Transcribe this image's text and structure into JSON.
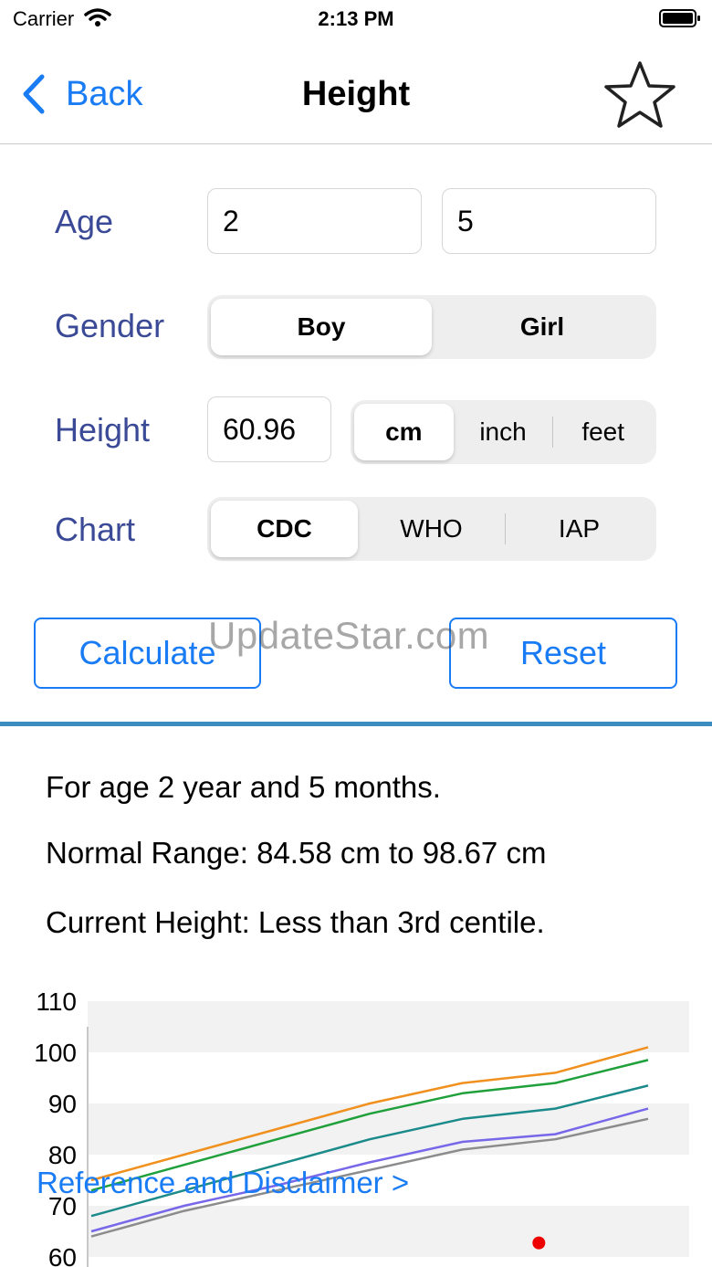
{
  "status_bar": {
    "carrier": "Carrier",
    "time": "2:13 PM"
  },
  "nav": {
    "back_label": "Back",
    "title": "Height"
  },
  "form": {
    "age_label": "Age",
    "age_years": "2",
    "age_months": "5",
    "gender_label": "Gender",
    "gender_options": [
      "Boy",
      "Girl"
    ],
    "gender_selected": "Boy",
    "height_label": "Height",
    "height_value": "60.96",
    "unit_options": [
      "cm",
      "inch",
      "feet"
    ],
    "unit_selected": "cm",
    "chart_label": "Chart",
    "chart_options": [
      "CDC",
      "WHO",
      "IAP"
    ],
    "chart_selected": "CDC"
  },
  "buttons": {
    "calculate": "Calculate",
    "reset": "Reset"
  },
  "watermark": "UpdateStar.com",
  "results": {
    "age_line": "For age  2 year and 5 months.",
    "range_line": "Normal Range: 84.58 cm to 98.67 cm",
    "current_line": "Current Height: Less than 3rd centile."
  },
  "reference_link": "Reference and Disclaimer >",
  "colors": {
    "accent": "#1a7cf5",
    "label": "#3b4a96",
    "divider": "#3b8cc0"
  },
  "chart_data": {
    "type": "line",
    "x": [
      0,
      1,
      2,
      3,
      4,
      5,
      6
    ],
    "y_ticks": [
      60,
      70,
      80,
      90,
      100,
      110
    ],
    "ylim": [
      60,
      110
    ],
    "series": [
      {
        "color": "#f0901e",
        "values": [
          75,
          80,
          85,
          90,
          94,
          96,
          101
        ]
      },
      {
        "color": "#1fa03a",
        "values": [
          73,
          78,
          83,
          88,
          92,
          94,
          98.5
        ]
      },
      {
        "color": "#1b8a8a",
        "values": [
          68,
          73,
          78,
          83,
          87,
          89,
          93.5
        ]
      },
      {
        "color": "#7668e8",
        "values": [
          65,
          70,
          74,
          78.5,
          82.5,
          84,
          89
        ]
      },
      {
        "color": "#8c8c8c",
        "values": [
          64,
          69,
          73,
          77,
          81,
          83,
          87
        ]
      }
    ],
    "current_point": {
      "x": 5,
      "y": 60.96,
      "color": "#ee0000"
    }
  }
}
